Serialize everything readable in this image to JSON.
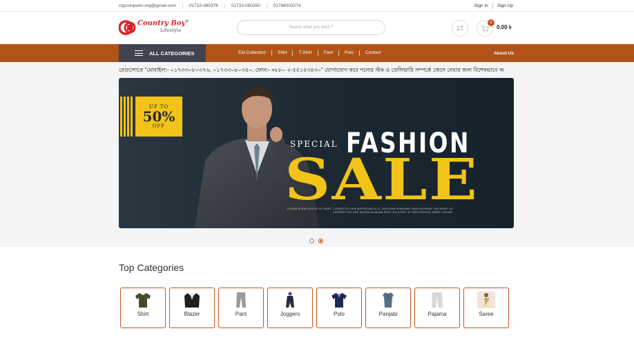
{
  "topbar": {
    "email": "ctgcomputer.org@gmail.com",
    "phones": [
      "01733-080376",
      "01733-080350",
      "01786003274"
    ],
    "sign_in": "Sign In",
    "sign_up": "Sign Up"
  },
  "header": {
    "brand": "Country Boy",
    "brand_sub": "Lifestyle",
    "search_placeholder": "Search what you want ?",
    "cart_count": "0",
    "cart_total": "0.00 ৳"
  },
  "nav": {
    "all_categories": "ALL CATEGORIES",
    "menu": [
      "Eid-Collection",
      "Shirt",
      "T-Shirt",
      "Pant",
      "Polo",
      "Contact"
    ],
    "about": "About Us"
  },
  "marquee": "রেগুলোতে \"মোবাইল:- ০১৭৩৩০৮০৩৭৬, ০১৭৩৩০৮০৩৫০, ফোন:- +৮৮০ ২-৫৫১৫৩৪৩০\" যোগাযোগ করে পন্যের স্টক ও ডেলিভারি সম্পর্কে জেনে নেয়ার জন্য বিশেষভাবে অ",
  "banner": {
    "badge_top": "UP TO",
    "badge_value": "50%",
    "badge_bottom": "OFF",
    "special": "SPECIAL",
    "fashion": "FASHION",
    "sale": "SALE",
    "lorem": "LOREM IPSUM DOLOR SIT AMET, CONSECTETUER ADIPISCING ELIT, SED DIAM NONUMMY NIBH EUISMOD TINCIDUNT UT LAOREET DOLORE MAGNA ALIQUAM ERAT VOLUTPAT. UT WISI ENIM AD MINIM VENIAM."
  },
  "slider": {
    "slides": 2,
    "active_slide": 2
  },
  "categories": {
    "title": "Top Categories",
    "items": [
      {
        "label": "Shirt",
        "icon": "shirt-icon"
      },
      {
        "label": "Blazer",
        "icon": "blazer-icon"
      },
      {
        "label": "Pant",
        "icon": "pant-icon"
      },
      {
        "label": "Joggers",
        "icon": "joggers-icon"
      },
      {
        "label": "Polo",
        "icon": "polo-icon"
      },
      {
        "label": "Panjabi",
        "icon": "panjabi-icon"
      },
      {
        "label": "Pajama",
        "icon": "pajama-icon"
      },
      {
        "label": "Saree",
        "icon": "saree-icon"
      }
    ]
  },
  "colors": {
    "nav_bg": "#b15317",
    "all_categories_bg": "#3f4450",
    "accent_yellow": "#f2c318",
    "brand_red": "#d6232a"
  }
}
